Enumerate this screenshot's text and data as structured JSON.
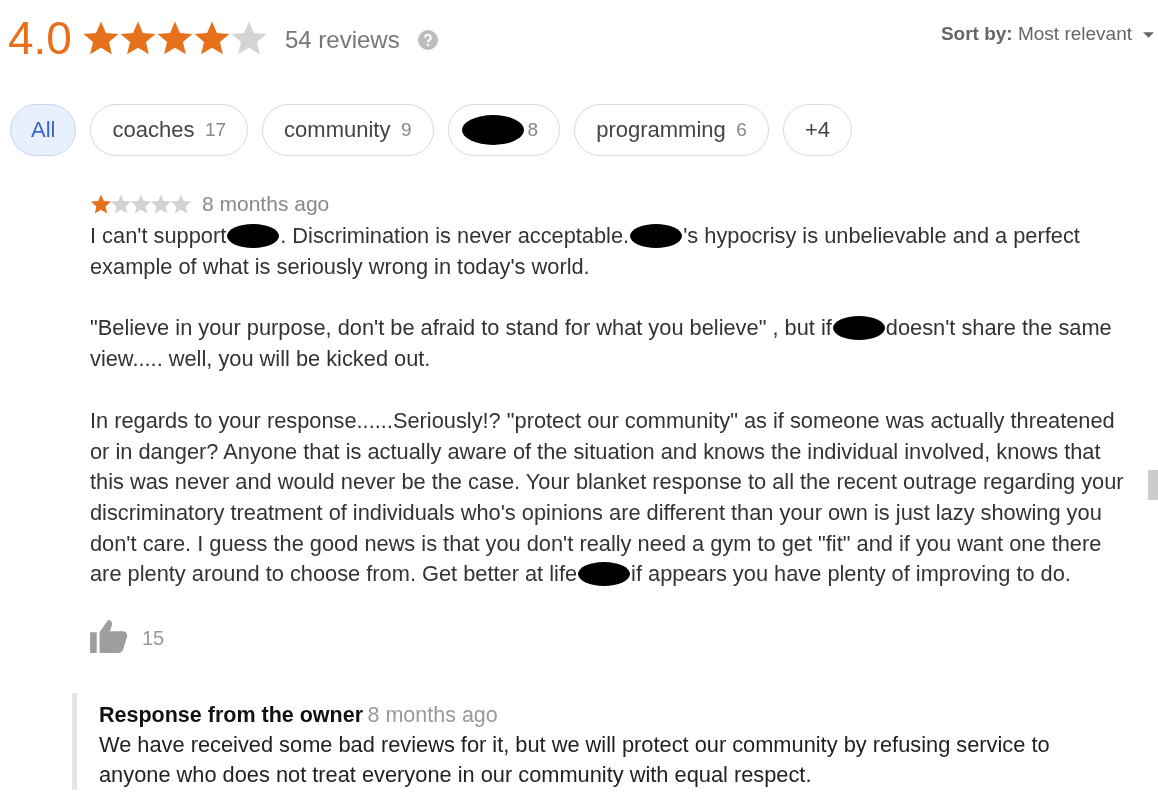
{
  "summary": {
    "rating": "4.0",
    "stars": 4,
    "review_count": "54 reviews"
  },
  "sort": {
    "label": "Sort by:",
    "value": "Most relevant"
  },
  "chips": [
    {
      "kind": "text",
      "label": "All",
      "selected": true
    },
    {
      "kind": "text",
      "label": "coaches",
      "count": "17",
      "selected": false
    },
    {
      "kind": "text",
      "label": "community",
      "count": "9",
      "selected": false
    },
    {
      "kind": "redacted",
      "count": "8",
      "selected": false
    },
    {
      "kind": "text",
      "label": "programming",
      "count": "6",
      "selected": false
    },
    {
      "kind": "text",
      "label": "+4",
      "selected": false
    }
  ],
  "review": {
    "stars": 1,
    "time": "8 months ago",
    "paragraphs": [
      [
        {
          "kind": "text",
          "text": "I can't support"
        },
        {
          "kind": "redacted"
        },
        {
          "kind": "text",
          "text": ". Discrimination is never acceptable."
        },
        {
          "kind": "redacted"
        },
        {
          "kind": "text",
          "text": "'s hypocrisy is unbelievable and a perfect example of what is seriously wrong in today's world."
        }
      ],
      [
        {
          "kind": "text",
          "text": "\"Believe in your purpose, don't be afraid to stand for what you believe\" , but if"
        },
        {
          "kind": "redacted"
        },
        {
          "kind": "text",
          "text": "doesn't share the same view..... well, you will be kicked out."
        }
      ],
      [
        {
          "kind": "text",
          "text": "In regards to your response......Seriously!?  \"protect our community\" as if someone was actually threatened or in danger? Anyone that is actually aware of the situation and knows the individual involved, knows that this was never and would never be the case. Your blanket response to all the recent outrage regarding your discriminatory treatment of individuals who's opinions are different than your own is just lazy showing you don't care. I guess the good news is that you don't really need a gym to get \"fit\" and if you want one there are plenty around to choose from. Get better at life"
        },
        {
          "kind": "redacted"
        },
        {
          "kind": "text",
          "text": "if appears you have plenty of improving to do."
        }
      ]
    ],
    "likes": "15",
    "response": {
      "title": "Response from the owner",
      "time": "8 months ago",
      "text": "We have received some bad reviews for it, but we will protect our community by refusing service to anyone who does not treat everyone in our community with equal respect."
    }
  }
}
